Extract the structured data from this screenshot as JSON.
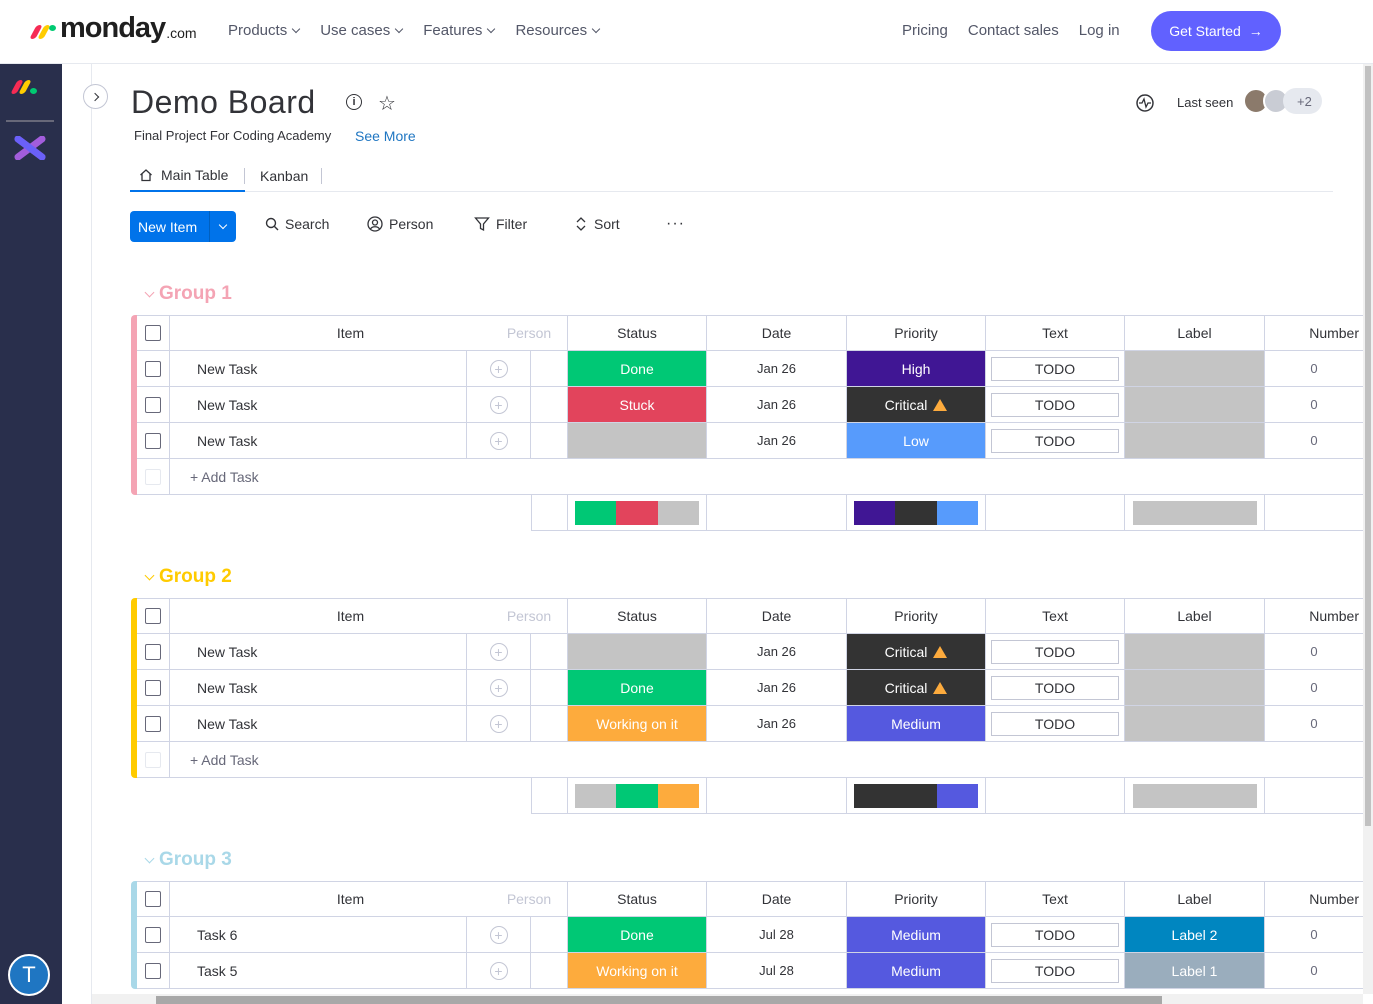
{
  "nav": {
    "logo_text": "monday",
    "logo_suffix": ".com",
    "menu": [
      "Products",
      "Use cases",
      "Features",
      "Resources"
    ],
    "right_links": [
      "Pricing",
      "Contact sales",
      "Log in"
    ],
    "cta": "Get Started"
  },
  "colors": {
    "brand_red": "#f62b54",
    "brand_yellow": "#ffcc00",
    "brand_green": "#00ca72",
    "accent": "#6161ff",
    "primary": "#0073ea",
    "sidebar": "#292f4c"
  },
  "sidebar": {
    "user_initial": "T"
  },
  "board": {
    "title": "Demo Board",
    "description": "Final Project For Coding Academy",
    "see_more": "See More",
    "last_seen": "Last seen",
    "more_users": "+2",
    "tabs": [
      "Main Table",
      "Kanban"
    ]
  },
  "toolbar": {
    "new_item": "New Item",
    "search": "Search",
    "person": "Person",
    "filter": "Filter",
    "sort": "Sort",
    "more": "···"
  },
  "columns": [
    "Item",
    "Person",
    "Status",
    "Date",
    "Priority",
    "Text",
    "Label",
    "Number"
  ],
  "add_task": "+ Add Task",
  "groups": [
    {
      "name": "Group 1",
      "color": "#f4a4b4",
      "rows": [
        {
          "name": "New Task",
          "status": "Done",
          "status_color": "#00c875",
          "date": "Jan 26",
          "priority": "High",
          "priority_color": "#401694",
          "priority_warn": false,
          "text": "TODO",
          "label": "",
          "label_color": "#c4c4c4",
          "number": "0"
        },
        {
          "name": "New Task",
          "status": "Stuck",
          "status_color": "#e2445c",
          "date": "Jan 26",
          "priority": "Critical",
          "priority_color": "#333333",
          "priority_warn": true,
          "text": "TODO",
          "label": "",
          "label_color": "#c4c4c4",
          "number": "0"
        },
        {
          "name": "New Task",
          "status": "",
          "status_color": "#c4c4c4",
          "date": "Jan 26",
          "priority": "Low",
          "priority_color": "#579bfc",
          "priority_warn": false,
          "text": "TODO",
          "label": "",
          "label_color": "#c4c4c4",
          "number": "0"
        }
      ],
      "status_summary": [
        {
          "color": "#00c875",
          "frac": 0.333
        },
        {
          "color": "#e2445c",
          "frac": 0.333
        },
        {
          "color": "#c4c4c4",
          "frac": 0.334
        }
      ],
      "priority_summary": [
        {
          "color": "#401694",
          "frac": 0.333
        },
        {
          "color": "#333333",
          "frac": 0.333
        },
        {
          "color": "#579bfc",
          "frac": 0.334
        }
      ]
    },
    {
      "name": "Group 2",
      "color": "#ffcb00",
      "rows": [
        {
          "name": "New Task",
          "status": "",
          "status_color": "#c4c4c4",
          "date": "Jan 26",
          "priority": "Critical",
          "priority_color": "#333333",
          "priority_warn": true,
          "text": "TODO",
          "label": "",
          "label_color": "#c4c4c4",
          "number": "0"
        },
        {
          "name": "New Task",
          "status": "Done",
          "status_color": "#00c875",
          "date": "Jan 26",
          "priority": "Critical",
          "priority_color": "#333333",
          "priority_warn": true,
          "text": "TODO",
          "label": "",
          "label_color": "#c4c4c4",
          "number": "0"
        },
        {
          "name": "New Task",
          "status": "Working on it",
          "status_color": "#fdab3d",
          "date": "Jan 26",
          "priority": "Medium",
          "priority_color": "#5559df",
          "priority_warn": false,
          "text": "TODO",
          "label": "",
          "label_color": "#c4c4c4",
          "number": "0"
        }
      ],
      "status_summary": [
        {
          "color": "#c4c4c4",
          "frac": 0.333
        },
        {
          "color": "#00c875",
          "frac": 0.333
        },
        {
          "color": "#fdab3d",
          "frac": 0.334
        }
      ],
      "priority_summary": [
        {
          "color": "#333333",
          "frac": 0.667
        },
        {
          "color": "#5559df",
          "frac": 0.333
        }
      ]
    },
    {
      "name": "Group 3",
      "color": "#a9d8e8",
      "rows": [
        {
          "name": "Task 6",
          "status": "Done",
          "status_color": "#00c875",
          "date": "Jul 28",
          "priority": "Medium",
          "priority_color": "#5559df",
          "priority_warn": false,
          "text": "TODO",
          "label": "Label 2",
          "label_color": "#0086c0",
          "number": "0"
        },
        {
          "name": "Task 5",
          "status": "Working on it",
          "status_color": "#fdab3d",
          "date": "Jul 28",
          "priority": "Medium",
          "priority_color": "#5559df",
          "priority_warn": false,
          "text": "TODO",
          "label": "Label 1",
          "label_color": "#9aadbd",
          "number": "0"
        }
      ]
    }
  ]
}
